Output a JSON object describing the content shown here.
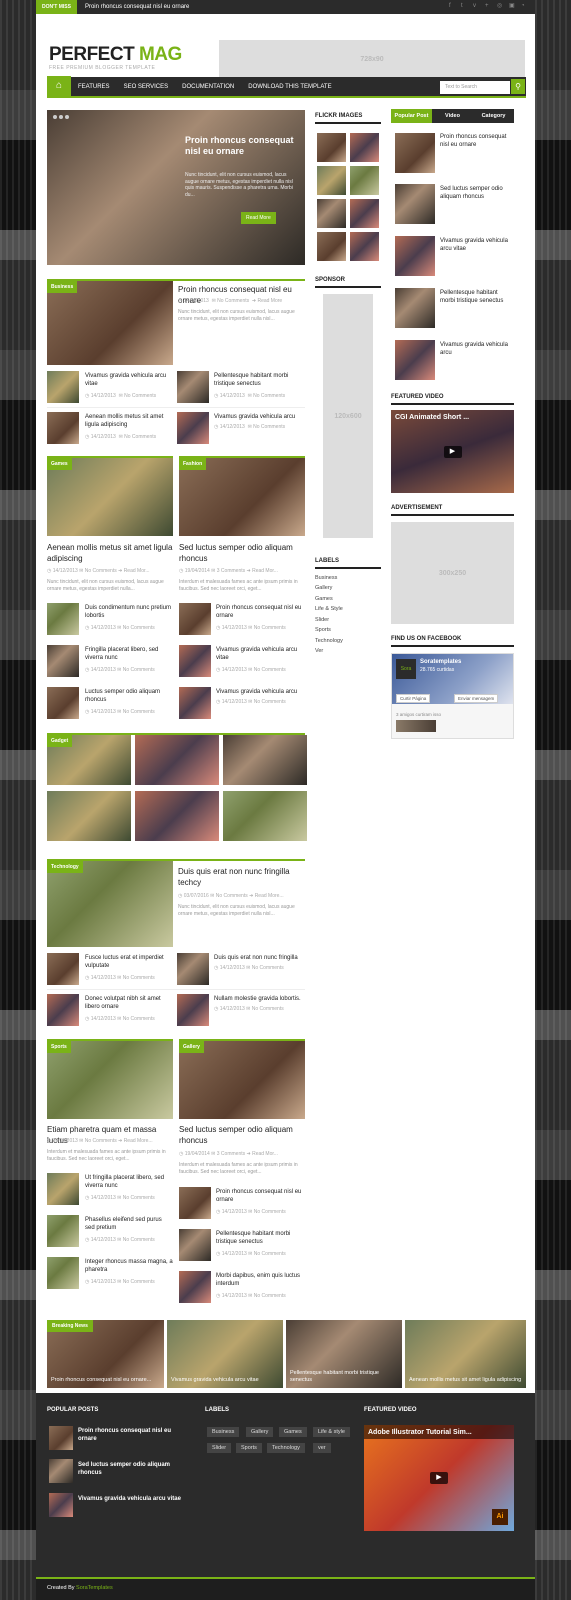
{
  "topbar": {
    "dont_miss": "DON'T MISS",
    "ticker": "Proin rhoncus consequat nisl eu ornare"
  },
  "header": {
    "logo_a": "PERFECT ",
    "logo_b": "MAG",
    "tagline": "FREE PREMIUM BLOGGER TEMPLATE",
    "ad": "728x90"
  },
  "nav": {
    "items": [
      "FEATURES",
      "SEO SERVICES",
      "DOCUMENTATION",
      "DOWNLOAD THIS TEMPLATE"
    ],
    "search_placeholder": "Text to Search"
  },
  "slider": {
    "title": "Proin rhoncus consequat nisl eu ornare",
    "excerpt": "Nunc tincidunt, elit non cursus euismod, lacus augue ornare metus, egestas imperdiet nulla nisl quis mauris. Suspendisse a pharetra urna. Morbi du...",
    "button": "Read More"
  },
  "business": {
    "tag": "Business",
    "title": "Proin rhoncus consequat nisl eu ornare",
    "date": "14/12/2013",
    "comments": "No Comments",
    "read": "Read More",
    "excerpt": "Nunc tincidunt, elit non cursus euismod, lacus augue ornare metus, egestas imperdiet nulla nisl...",
    "items": [
      {
        "t": "Vivamus gravida vehicula arcu vitae",
        "d": "14/12/2013",
        "c": "No Comments"
      },
      {
        "t": "Pellentesque habitant morbi tristique senectus",
        "d": "14/12/2013",
        "c": "No Comments"
      },
      {
        "t": "Aenean mollis metus sit amet ligula adipiscing",
        "d": "14/12/2013",
        "c": "No Comments"
      },
      {
        "t": "Vivamus gravida vehicula arcu",
        "d": "14/12/2013",
        "c": "No Comments"
      }
    ]
  },
  "games": {
    "tag": "Games",
    "title": "Aenean mollis metus sit amet ligula adipiscing",
    "date": "14/12/2013",
    "comments": "No Comments",
    "read": "Read Mor...",
    "excerpt": "Nunc tincidunt, elit non cursus euismod, lacus augue ornare metus, egestas imperdiet nulla...",
    "items": [
      {
        "t": "Duis condimentum nunc pretium lobortis",
        "d": "14/12/2013",
        "c": "No Comments"
      },
      {
        "t": "Fringilla placerat libero, sed viverra nunc",
        "d": "14/12/2013",
        "c": "No Comments"
      },
      {
        "t": "Luctus semper odio aliquam rhoncus",
        "d": "14/12/2013",
        "c": "No Comments"
      }
    ]
  },
  "fashion": {
    "tag": "Fashion",
    "title": "Sed luctus semper odio aliquam rhoncus",
    "date": "19/04/2014",
    "comments": "3 Comments",
    "read": "Read Mor...",
    "excerpt": "Interdum et malesuada fames ac ante ipsum primis in faucibus. Sed nec laoreet orci, eget...",
    "items": [
      {
        "t": "Proin rhoncus consequat nisl eu ornare",
        "d": "14/12/2013",
        "c": "No Comments"
      },
      {
        "t": "Vivamus gravida vehicula arcu vitae",
        "d": "14/12/2013",
        "c": "No Comments"
      },
      {
        "t": "Vivamus gravida vehicula arcu",
        "d": "14/12/2013",
        "c": "No Comments"
      }
    ]
  },
  "gadget": {
    "tag": "Gadget"
  },
  "technology": {
    "tag": "Technology",
    "title": "Duis quis erat non nunc fringilla techcy",
    "date": "03/07/2016",
    "comments": "No Comments",
    "read": "Read More...",
    "excerpt": "Nunc tincidunt, elit non cursus euismod, lacus augue ornare metus, egestas imperdiet nulla nisl...",
    "items": [
      {
        "t": "Fusce luctus erat et imperdiet vulputate",
        "d": "14/12/2013",
        "c": "No Comments"
      },
      {
        "t": "Duis quis erat non nunc fringilla",
        "d": "14/12/2013",
        "c": "No Comments"
      },
      {
        "t": "Donec volutpat nibh sit amet libero ornare",
        "d": "14/12/2013",
        "c": "No Comments"
      },
      {
        "t": "Nullam molestie gravida lobortis.",
        "d": "14/12/2013",
        "c": "No Comments"
      }
    ]
  },
  "sports": {
    "tag": "Sports",
    "title": "Etiam pharetra quam et massa luctus",
    "date": "14/12/2013",
    "comments": "No Comments",
    "read": "Read More...",
    "excerpt": "Interdum et malesuada fames ac ante ipsum primis in faucibus. Sed nec laoreet orci, eget...",
    "items": [
      {
        "t": "Ut fringilla placerat libero, sed viverra nunc",
        "d": "14/12/2013",
        "c": "No Comments"
      },
      {
        "t": "Phasellus eleifend sed purus sed pretium",
        "d": "14/12/2013",
        "c": "No Comments"
      },
      {
        "t": "Integer rhoncus massa magna, a pharetra",
        "d": "14/12/2013",
        "c": "No Comments"
      }
    ]
  },
  "gallery": {
    "tag": "Gallery",
    "title": "Sed luctus semper odio aliquam rhoncus",
    "date": "19/04/2014",
    "comments": "3 Comments",
    "read": "Read Mor...",
    "excerpt": "Interdum et malesuada fames ac ante ipsum primis in faucibus. Sed nec laoreet orci, eget...",
    "items": [
      {
        "t": "Proin rhoncus consequat nisl eu ornare",
        "d": "14/12/2013",
        "c": "No Comments"
      },
      {
        "t": "Pellentesque habitant morbi tristique senectus",
        "d": "14/12/2013",
        "c": "No Comments"
      },
      {
        "t": "Morbi dapibus, enim quis luctus interdum",
        "d": "14/12/2013",
        "c": "No Comments"
      }
    ]
  },
  "mid": {
    "flickr": "FLICKR IMAGES",
    "sponsor": "SPONSOR",
    "sponsor_ad": "120x600",
    "labels_title": "LABELS",
    "labels": [
      "Business",
      "Gallery",
      "Games",
      "Life & Style",
      "Slider",
      "Sports",
      "Technology",
      "Ver"
    ]
  },
  "right": {
    "tabs": [
      "Popular Post",
      "Video",
      "Category"
    ],
    "popular": [
      "Proin rhoncus consequat nisl eu ornare",
      "Sed luctus semper odio aliquam rhoncus",
      "Vivamus gravida vehicula arcu vitae",
      "Pellentesque habitant morbi tristique senectus",
      "Vivamus gravida vehicula arcu"
    ],
    "featured_video": "FEATURED VIDEO",
    "video_title": "CGI Animated Short ...",
    "advert": "ADVERTISEMENT",
    "advert_ad": "300x250",
    "facebook": "FIND US ON FACEBOOK",
    "fb_name": "Soratemplates",
    "fb_likes": "28.765 curtidas",
    "fb_like_btn": "Curtir Página",
    "fb_msg_btn": "Enviar mensagem",
    "fb_friends": "3 amigos curtiram isso"
  },
  "breaking": {
    "label": "Breaking News",
    "items": [
      "Proin rhoncus consequat nisl eu ornare...",
      "Vivamus gravida vehicula arcu vitae",
      "Pellentesque habitant morbi tristique senectus",
      "Aenean mollis metus sit amet ligula adipiscing"
    ]
  },
  "footer": {
    "popular_title": "POPULAR POSTS",
    "popular": [
      "Proin rhoncus consequat nisl eu ornare",
      "Sed luctus semper odio aliquam rhoncus",
      "Vivamus gravida vehicula arcu vitae"
    ],
    "labels_title": "LABELS",
    "labels": [
      "Business",
      "Gallery",
      "Games",
      "Life & style",
      "Slider",
      "Sports",
      "Technology",
      "ver"
    ],
    "video_title": "FEATURED VIDEO",
    "video_caption": "Adobe Illustrator Tutorial Sim...",
    "credit_a": "Created By ",
    "credit_b": "SoraTemplates"
  },
  "colors": {
    "accent": "#7ab317",
    "dark": "#2b2b2b"
  }
}
